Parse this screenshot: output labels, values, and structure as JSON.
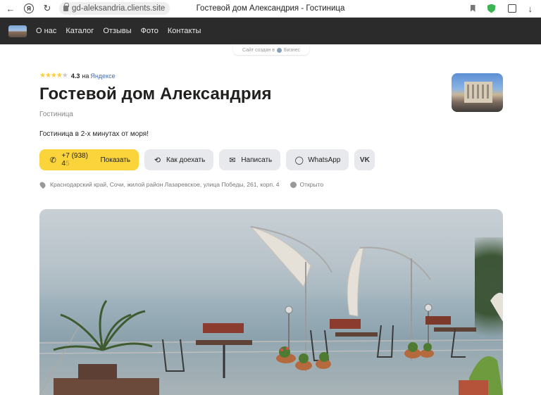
{
  "browser": {
    "url": "gd-aleksandria.clients.site",
    "tab_title": "Гостевой дом Александрия - Гостиница"
  },
  "site_nav": {
    "items": [
      "О нас",
      "Каталог",
      "Отзывы",
      "Фото",
      "Контакты"
    ]
  },
  "badge": {
    "text": "Сайт создан в",
    "brand": "Бизнес"
  },
  "business": {
    "rating_value": "4.3",
    "rating_on": "на",
    "rating_source": "Яндексе",
    "stars_filled": 4,
    "stars_total": 5,
    "name": "Гостевой дом Александрия",
    "category": "Гостиница",
    "description": "Гостиница в 2-х минутах от моря!"
  },
  "actions": {
    "phone_visible": "+7 (938) 4",
    "phone_fade": "5",
    "show_label": "Показать",
    "route_label": "Как доехать",
    "write_label": "Написать",
    "whatsapp_label": "WhatsApp",
    "vk_label": "VK"
  },
  "address": {
    "text": "Краснодарский край, Сочи, жилой район Лазаревское, улица Победы, 261, корп. 4",
    "status": "Открыто"
  },
  "colors": {
    "accent": "#fbd33b",
    "nav_bg": "#2b2b2b",
    "button_bg": "#e8e9ed",
    "link": "#3d6bb3"
  }
}
